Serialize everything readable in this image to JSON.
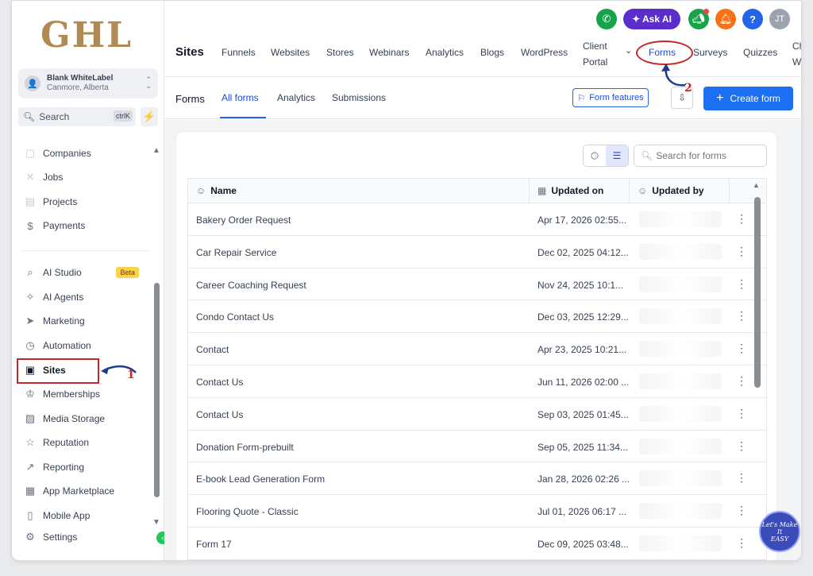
{
  "brand": {
    "logo": "GHL"
  },
  "account": {
    "name": "Blank WhiteLabel",
    "location": "Canmore, Alberta",
    "avatar_initial": "👤"
  },
  "sidebar_search": {
    "label": "Search",
    "shortcut": "ctrlK"
  },
  "sidebar": {
    "items": [
      {
        "label": "Companies",
        "icon": "building-icon",
        "glyph": "▢"
      },
      {
        "label": "Jobs",
        "icon": "jobs-icon",
        "glyph": "✕"
      },
      {
        "label": "Projects",
        "icon": "projects-icon",
        "glyph": "▤"
      },
      {
        "label": "Payments",
        "icon": "payments-icon",
        "glyph": "$"
      },
      {
        "label": "AI Studio",
        "icon": "ai-studio-icon",
        "glyph": "⌕",
        "badge": "Beta"
      },
      {
        "label": "AI Agents",
        "icon": "ai-agents-icon",
        "glyph": "✧"
      },
      {
        "label": "Marketing",
        "icon": "marketing-icon",
        "glyph": "➤"
      },
      {
        "label": "Automation",
        "icon": "automation-icon",
        "glyph": "◷"
      },
      {
        "label": "Sites",
        "icon": "sites-icon",
        "glyph": "▣"
      },
      {
        "label": "Memberships",
        "icon": "memberships-icon",
        "glyph": "♔"
      },
      {
        "label": "Media Storage",
        "icon": "media-storage-icon",
        "glyph": "▨"
      },
      {
        "label": "Reputation",
        "icon": "reputation-icon",
        "glyph": "☆"
      },
      {
        "label": "Reporting",
        "icon": "reporting-icon",
        "glyph": "↗"
      },
      {
        "label": "App Marketplace",
        "icon": "app-marketplace-icon",
        "glyph": "▦"
      },
      {
        "label": "Mobile App",
        "icon": "mobile-app-icon",
        "glyph": "▯"
      },
      {
        "label": "Settings",
        "icon": "settings-icon",
        "glyph": "⚙"
      }
    ]
  },
  "topbar": {
    "title": "Sites",
    "nav": [
      "Funnels",
      "Websites",
      "Stores",
      "Webinars",
      "Analytics",
      "Blogs",
      "WordPress"
    ],
    "client_portal": [
      "Client",
      "Portal"
    ],
    "forms": "Forms",
    "surveys": "Surveys",
    "quizzes": "Quizzes",
    "chat_widget": [
      "Chat",
      "Widg"
    ],
    "ask_ai": "✦ Ask AI",
    "user_initials": "JT"
  },
  "subheader": {
    "title": "Forms",
    "tabs": [
      "All forms",
      "Analytics",
      "Submissions"
    ],
    "form_features": "Form features",
    "create_form": "Create form"
  },
  "table": {
    "search_placeholder": "Search for forms",
    "columns": [
      "Name",
      "Updated on",
      "Updated by"
    ],
    "rows": [
      {
        "name": "Bakery Order Request",
        "updated_on": "Apr 17, 2026 02:55..."
      },
      {
        "name": "Car Repair Service",
        "updated_on": "Dec 02, 2025 04:12..."
      },
      {
        "name": "Career Coaching Request",
        "updated_on": "Nov 24, 2025 10:1..."
      },
      {
        "name": "Condo Contact Us",
        "updated_on": "Dec 03, 2025 12:29..."
      },
      {
        "name": "Contact",
        "updated_on": "Apr 23, 2025 10:21..."
      },
      {
        "name": "Contact Us",
        "updated_on": "Jun 11, 2026 02:00 ..."
      },
      {
        "name": "Contact Us",
        "updated_on": "Sep 03, 2025 01:45..."
      },
      {
        "name": "Donation Form-prebuilt",
        "updated_on": "Sep 05, 2025 11:34..."
      },
      {
        "name": "E-book Lead Generation Form",
        "updated_on": "Jan 28, 2026 02:26 ..."
      },
      {
        "name": "Flooring Quote - Classic",
        "updated_on": "Jul 01, 2026 06:17 ..."
      },
      {
        "name": "Form 17",
        "updated_on": "Dec 09, 2025 03:48..."
      }
    ]
  },
  "annotations": {
    "step1": "1",
    "step2": "2",
    "badge_text": [
      "Let's Make",
      "It",
      "EASY"
    ]
  },
  "colors": {
    "accent": "#1d6ff2",
    "callout": "#c62828",
    "brand": "#b08a55",
    "ask_ai": "#5b2ecc"
  }
}
